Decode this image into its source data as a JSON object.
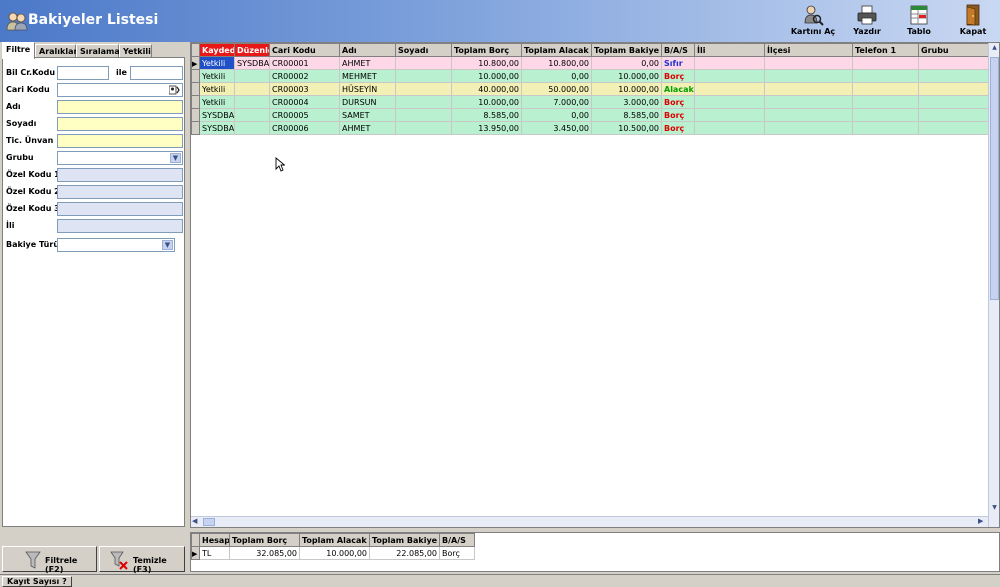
{
  "window": {
    "title": "Bakiyeler Listesi"
  },
  "toolbar": {
    "card_open": "Kartını Aç",
    "print": "Yazdır",
    "table": "Tablo",
    "close": "Kapat"
  },
  "filter_panel": {
    "tabs": [
      "Filtre",
      "Aralıklar",
      "Sıralama",
      "Yetkili"
    ],
    "active_tab": "Filtre",
    "fields": {
      "bil_cr_kodu": "Bil Cr.Kodu",
      "ile": "ile",
      "cari_kodu": "Cari Kodu",
      "adi": "Adı",
      "soyadi": "Soyadı",
      "tic_unvan": "Tic. Ünvan",
      "grubu": "Grubu",
      "ozel_kodu_1": "Özel Kodu 1",
      "ozel_kodu_2": "Özel Kodu 2",
      "ozel_kodu_3": "Özel Kodu 3",
      "ili": "İli",
      "bakiye_turu": "Bakiye Türü"
    },
    "filter_button": "Filtrele (F2)",
    "clear_button": "Temizle (F3)"
  },
  "grid": {
    "columns": [
      "Kaydede",
      "Düzenle",
      "Cari Kodu",
      "Adı",
      "Soyadı",
      "Toplam Borç",
      "Toplam Alacak",
      "Toplam Bakiye",
      "B/A/S",
      "İli",
      "İlçesi",
      "Telefon 1",
      "Grubu"
    ],
    "rows": [
      {
        "kaydeden": "Yetkili",
        "duzenle": "SYSDBA",
        "cari_kodu": "CR00001",
        "adi": "AHMET",
        "soyadi": "",
        "borc": "10.800,00",
        "alacak": "10.800,00",
        "bakiye": "0,00",
        "bas": "Sıfır"
      },
      {
        "kaydeden": "Yetkili",
        "duzenle": "",
        "cari_kodu": "CR00002",
        "adi": "MEHMET",
        "soyadi": "",
        "borc": "10.000,00",
        "alacak": "0,00",
        "bakiye": "10.000,00",
        "bas": "Borç"
      },
      {
        "kaydeden": "Yetkili",
        "duzenle": "",
        "cari_kodu": "CR00003",
        "adi": "HÜSEYİN",
        "soyadi": "",
        "borc": "40.000,00",
        "alacak": "50.000,00",
        "bakiye": "10.000,00",
        "bas": "Alacak"
      },
      {
        "kaydeden": "Yetkili",
        "duzenle": "",
        "cari_kodu": "CR00004",
        "adi": "DURSUN",
        "soyadi": "",
        "borc": "10.000,00",
        "alacak": "7.000,00",
        "bakiye": "3.000,00",
        "bas": "Borç"
      },
      {
        "kaydeden": "SYSDBA",
        "duzenle": "",
        "cari_kodu": "CR00005",
        "adi": "SAMET",
        "soyadi": "",
        "borc": "8.585,00",
        "alacak": "0,00",
        "bakiye": "8.585,00",
        "bas": "Borç"
      },
      {
        "kaydeden": "SYSDBA",
        "duzenle": "",
        "cari_kodu": "CR00006",
        "adi": "AHMET",
        "soyadi": "",
        "borc": "13.950,00",
        "alacak": "3.450,00",
        "bakiye": "10.500,00",
        "bas": "Borç"
      }
    ]
  },
  "summary": {
    "columns": [
      "Hesap",
      "Toplam Borç",
      "Toplam Alacak",
      "Toplam Bakiye",
      "B/A/S"
    ],
    "row": {
      "hesap": "TL",
      "borc": "32.085,00",
      "alacak": "10.000,00",
      "bakiye": "22.085,00",
      "bas": "Borç"
    }
  },
  "statusbar": {
    "record_count_button": "Kayıt Sayısı ?"
  },
  "colors": {
    "row_pink": "#ffd8e8",
    "row_green": "#b8f0d0",
    "row_yellow": "#f2f0b4",
    "bas_sifir": "#2030d0",
    "bas_borc": "#e00000",
    "bas_alacak": "#00a000"
  }
}
